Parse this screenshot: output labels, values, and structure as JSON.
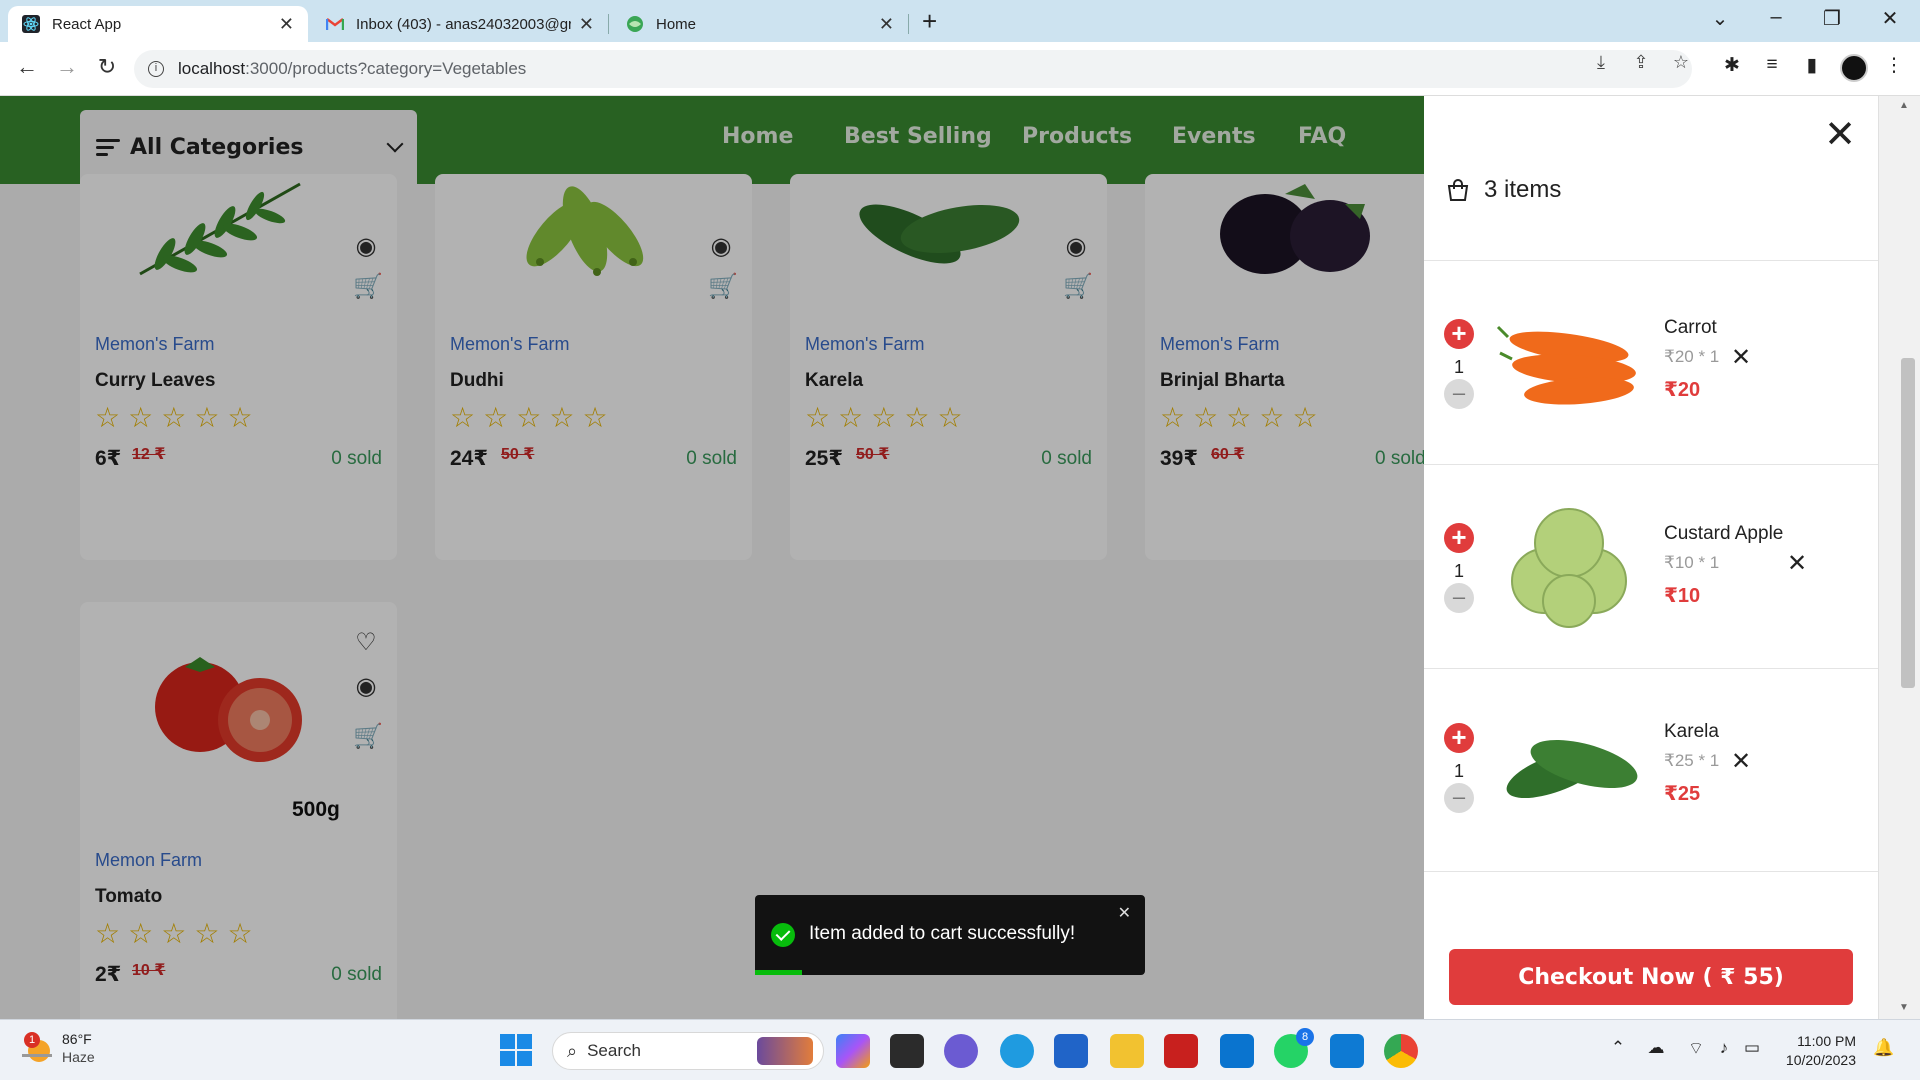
{
  "browser": {
    "tabs": [
      {
        "title": "React App",
        "icon": "react-icon",
        "active": true
      },
      {
        "title": "Inbox (403) - anas24032003@gr",
        "icon": "gmail-icon",
        "active": false
      },
      {
        "title": "Home",
        "icon": "globe-icon",
        "active": false
      }
    ],
    "new_tab": "+",
    "url_host": "localhost",
    "url_path": ":3000/products?category=Vegetables"
  },
  "header": {
    "category_label": "All Categories",
    "nav": [
      "Home",
      "Best Selling",
      "Products",
      "Events",
      "FAQ"
    ]
  },
  "products": [
    {
      "shop": "Memon's Farm",
      "name": "Curry Leaves",
      "price": "6₹",
      "old_price": "12 ₹",
      "sold": "0 sold"
    },
    {
      "shop": "Memon's Farm",
      "name": "Dudhi",
      "price": "24₹",
      "old_price": "50 ₹",
      "sold": "0 sold"
    },
    {
      "shop": "Memon's Farm",
      "name": "Karela",
      "price": "25₹",
      "old_price": "50 ₹",
      "sold": "0 sold"
    },
    {
      "shop": "Memon's Farm",
      "name": "Brinjal Bharta",
      "price": "39₹",
      "old_price": "60 ₹",
      "sold": "0 sold"
    },
    {
      "shop": "Memon Farm",
      "name": "Tomato",
      "price": "2₹",
      "old_price": "10 ₹",
      "sold": "0 sold",
      "weight_label": "500g"
    }
  ],
  "cart": {
    "count_label": "3 items",
    "items": [
      {
        "name": "Carrot",
        "calc": "₹20 * 1",
        "total": "₹20",
        "qty": "1"
      },
      {
        "name": "Custard Apple",
        "calc": "₹10 * 1",
        "total": "₹10",
        "qty": "1"
      },
      {
        "name": "Karela",
        "calc": "₹25 * 1",
        "total": "₹25",
        "qty": "1"
      }
    ],
    "checkout_label": "Checkout Now ( ₹ 55)"
  },
  "toast": {
    "message": "Item added to cart successfully!",
    "progress": 0.12
  },
  "taskbar": {
    "temperature": "86°F",
    "condition": "Haze",
    "weather_badge": "1",
    "search_placeholder": "Search",
    "whatsapp_badge": "8",
    "time": "11:00 PM",
    "date": "10/20/2023"
  },
  "colors": {
    "header_green": "#3a8b32",
    "accent_red": "#e03c3c",
    "star_gold": "#e8b500",
    "link_blue": "#3a6cc9",
    "sold_green": "#3a9a5c"
  }
}
